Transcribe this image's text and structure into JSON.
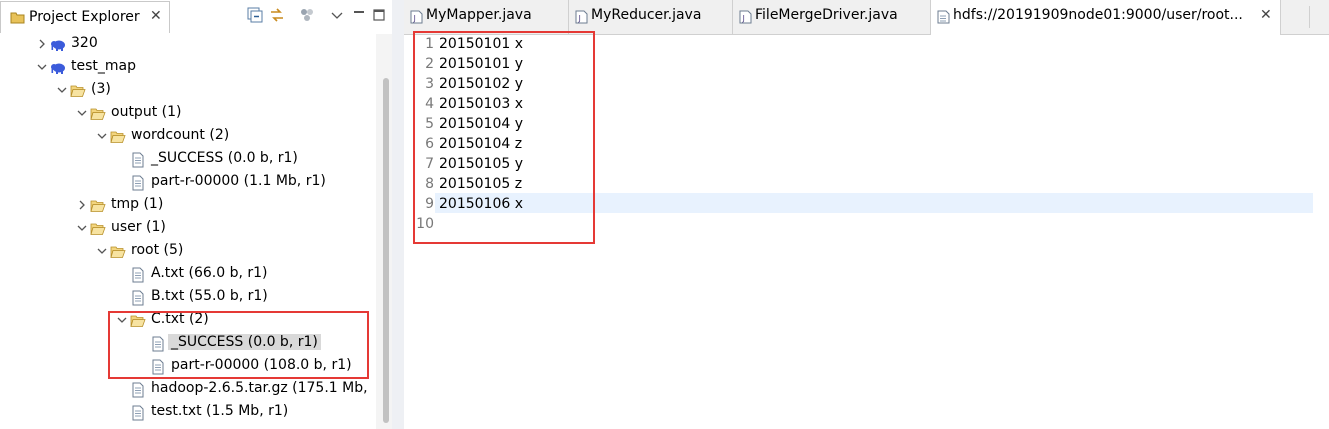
{
  "project_explorer": {
    "title": "Project Explorer",
    "close_glyph": "✕"
  },
  "tree": [
    {
      "label": "320",
      "icon": "elephant-icon",
      "twisty": "collapsed"
    },
    {
      "label": "test_map",
      "icon": "elephant-icon",
      "twisty": "expanded"
    },
    {
      "label": "(3)",
      "icon": "folder-open-icon",
      "twisty": "expanded"
    },
    {
      "label": "output (1)",
      "icon": "folder-open-icon",
      "twisty": "expanded"
    },
    {
      "label": "wordcount (2)",
      "icon": "folder-open-icon",
      "twisty": "expanded"
    },
    {
      "label": "_SUCCESS (0.0 b, r1)",
      "icon": "file-icon",
      "twisty": "none"
    },
    {
      "label": "part-r-00000 (1.1 Mb, r1)",
      "icon": "file-icon",
      "twisty": "none"
    },
    {
      "label": "tmp (1)",
      "icon": "folder-open-icon",
      "twisty": "collapsed"
    },
    {
      "label": "user (1)",
      "icon": "folder-open-icon",
      "twisty": "expanded"
    },
    {
      "label": "root (5)",
      "icon": "folder-open-icon",
      "twisty": "expanded"
    },
    {
      "label": "A.txt (66.0 b, r1)",
      "icon": "file-icon",
      "twisty": "none"
    },
    {
      "label": "B.txt (55.0 b, r1)",
      "icon": "file-icon",
      "twisty": "none"
    },
    {
      "label": "C.txt (2)",
      "icon": "folder-open-icon",
      "twisty": "expanded"
    },
    {
      "label": "_SUCCESS (0.0 b, r1)",
      "icon": "file-icon",
      "twisty": "none",
      "selected": true
    },
    {
      "label": "part-r-00000 (108.0 b, r1)",
      "icon": "file-icon",
      "twisty": "none"
    },
    {
      "label": "hadoop-2.6.5.tar.gz (175.1 Mb,",
      "icon": "file-icon",
      "twisty": "none"
    },
    {
      "label": "test.txt (1.5 Mb, r1)",
      "icon": "file-icon",
      "twisty": "none"
    }
  ],
  "editor": {
    "tabs": [
      {
        "label": "MyMapper.java",
        "icon": "java-file-icon"
      },
      {
        "label": "MyReducer.java",
        "icon": "java-file-icon"
      },
      {
        "label": "FileMergeDriver.java",
        "icon": "java-file-icon"
      },
      {
        "label": "hdfs://20191909node01:9000/user/root...",
        "icon": "text-file-icon",
        "active": true
      }
    ],
    "tab_close_glyph": "✕",
    "lines": [
      {
        "num": "1",
        "text": "20150101 x"
      },
      {
        "num": "2",
        "text": "20150101 y"
      },
      {
        "num": "3",
        "text": "20150102 y"
      },
      {
        "num": "4",
        "text": "20150103 x"
      },
      {
        "num": "5",
        "text": "20150104 y"
      },
      {
        "num": "6",
        "text": "20150104 z"
      },
      {
        "num": "7",
        "text": "20150105 y"
      },
      {
        "num": "8",
        "text": "20150105 z"
      },
      {
        "num": "9",
        "text": "20150106 x"
      },
      {
        "num": "10",
        "text": ""
      }
    ]
  },
  "colors": {
    "highlight_box": "#e53935",
    "current_line": "#e8f2fe",
    "selection": "#d9d9d9"
  }
}
